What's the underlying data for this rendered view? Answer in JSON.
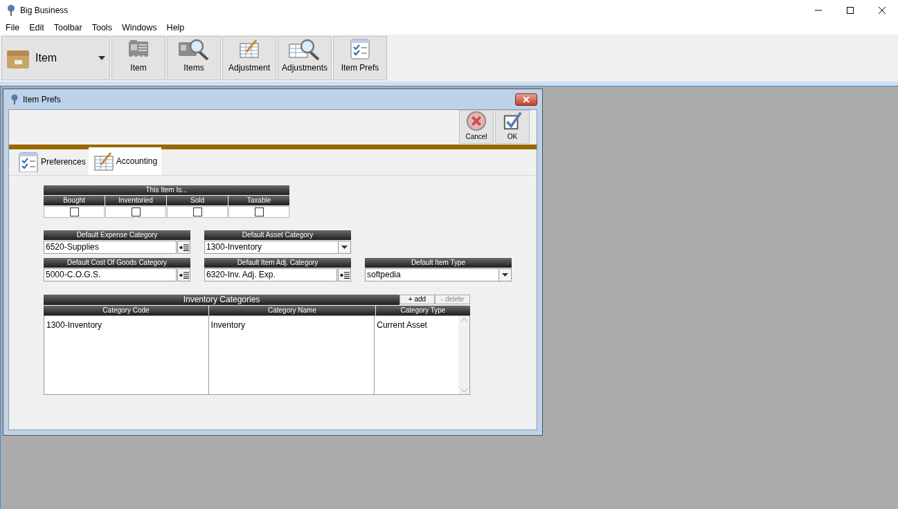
{
  "window": {
    "title": "Big Business"
  },
  "menu": [
    "File",
    "Edit",
    "Toolbar",
    "Tools",
    "Windows",
    "Help"
  ],
  "toolbar": {
    "module": {
      "label": "Item"
    },
    "buttons": [
      {
        "label": "Item",
        "kind": "card"
      },
      {
        "label": "Items",
        "kind": "card-search"
      },
      {
        "label": "Adjustment",
        "kind": "sheet"
      },
      {
        "label": "Adjustments",
        "kind": "sheet-search"
      },
      {
        "label": "Item Prefs",
        "kind": "checklist"
      }
    ]
  },
  "dialog": {
    "title": "Item Prefs",
    "actions": [
      {
        "label": "Cancel",
        "kind": "cancel"
      },
      {
        "label": "OK",
        "kind": "ok"
      }
    ],
    "tabs": [
      {
        "label": "Preferences",
        "kind": "checklist",
        "selected": false
      },
      {
        "label": "Accounting",
        "kind": "sheet",
        "selected": true
      }
    ],
    "flags": {
      "title": "This Item Is...",
      "items": [
        {
          "label": "Bought",
          "checked": false
        },
        {
          "label": "Inventoried",
          "checked": false
        },
        {
          "label": "Sold",
          "checked": false
        },
        {
          "label": "Taxable",
          "checked": false
        }
      ]
    },
    "field_rows": [
      [
        {
          "label": "Default Expense Category",
          "value": "6520-Supplies",
          "kind": "lookup"
        },
        {
          "label": "Default Asset Category",
          "value": "1300-Inventory",
          "kind": "dropdown"
        }
      ],
      [
        {
          "label": "Default Cost Of Goods Category",
          "value": "5000-C.O.G.S.",
          "kind": "lookup"
        },
        {
          "label": "Default Item Adj. Category",
          "value": "6320-Inv. Adj. Exp.",
          "kind": "lookup"
        },
        {
          "label": "Default Item Type",
          "value": "softpedia",
          "kind": "dropdown"
        }
      ]
    ],
    "table": {
      "title": "Inventory Categories",
      "actions": [
        {
          "label": "+ add",
          "disabled": false
        },
        {
          "label": "- delete",
          "disabled": true
        }
      ],
      "columns": [
        "Category Code",
        "Category Name",
        "Category Type"
      ],
      "rows": [
        [
          "1300-Inventory",
          "Inventory",
          "Current Asset"
        ]
      ]
    }
  }
}
